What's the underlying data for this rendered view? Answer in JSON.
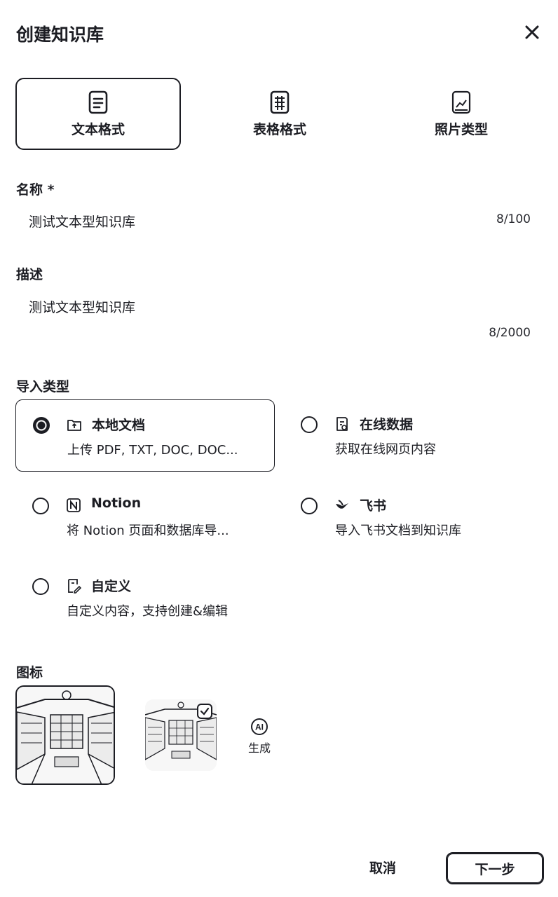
{
  "dialog": {
    "title": "创建知识库"
  },
  "format_tabs": [
    {
      "label": "文本格式",
      "selected": true,
      "icon": "text-doc-icon"
    },
    {
      "label": "表格格式",
      "selected": false,
      "icon": "table-icon"
    },
    {
      "label": "照片类型",
      "selected": false,
      "icon": "photo-icon"
    }
  ],
  "name_field": {
    "label": "名称 *",
    "value": "测试文本型知识库",
    "counter": "8/100"
  },
  "description_field": {
    "label": "描述",
    "value": "测试文本型知识库",
    "counter": "8/2000"
  },
  "import_type": {
    "label": "导入类型",
    "options": [
      {
        "title": "本地文档",
        "description": "上传 PDF, TXT, DOC, DOC...",
        "selected": true,
        "icon": "upload-folder-icon"
      },
      {
        "title": "在线数据",
        "description": "获取在线网页内容",
        "selected": false,
        "icon": "web-doc-icon"
      },
      {
        "title": "Notion",
        "description": "将 Notion 页面和数据库导...",
        "selected": false,
        "icon": "notion-icon"
      },
      {
        "title": "飞书",
        "description": "导入飞书文档到知识库",
        "selected": false,
        "icon": "feishu-icon"
      },
      {
        "title": "自定义",
        "description": "自定义内容，支持创建&编辑",
        "selected": false,
        "icon": "edit-doc-icon"
      }
    ]
  },
  "icon_section": {
    "label": "图标",
    "ai_badge": "AI",
    "ai_label": "生成"
  },
  "footer": {
    "cancel_label": "取消",
    "next_label": "下一步"
  }
}
